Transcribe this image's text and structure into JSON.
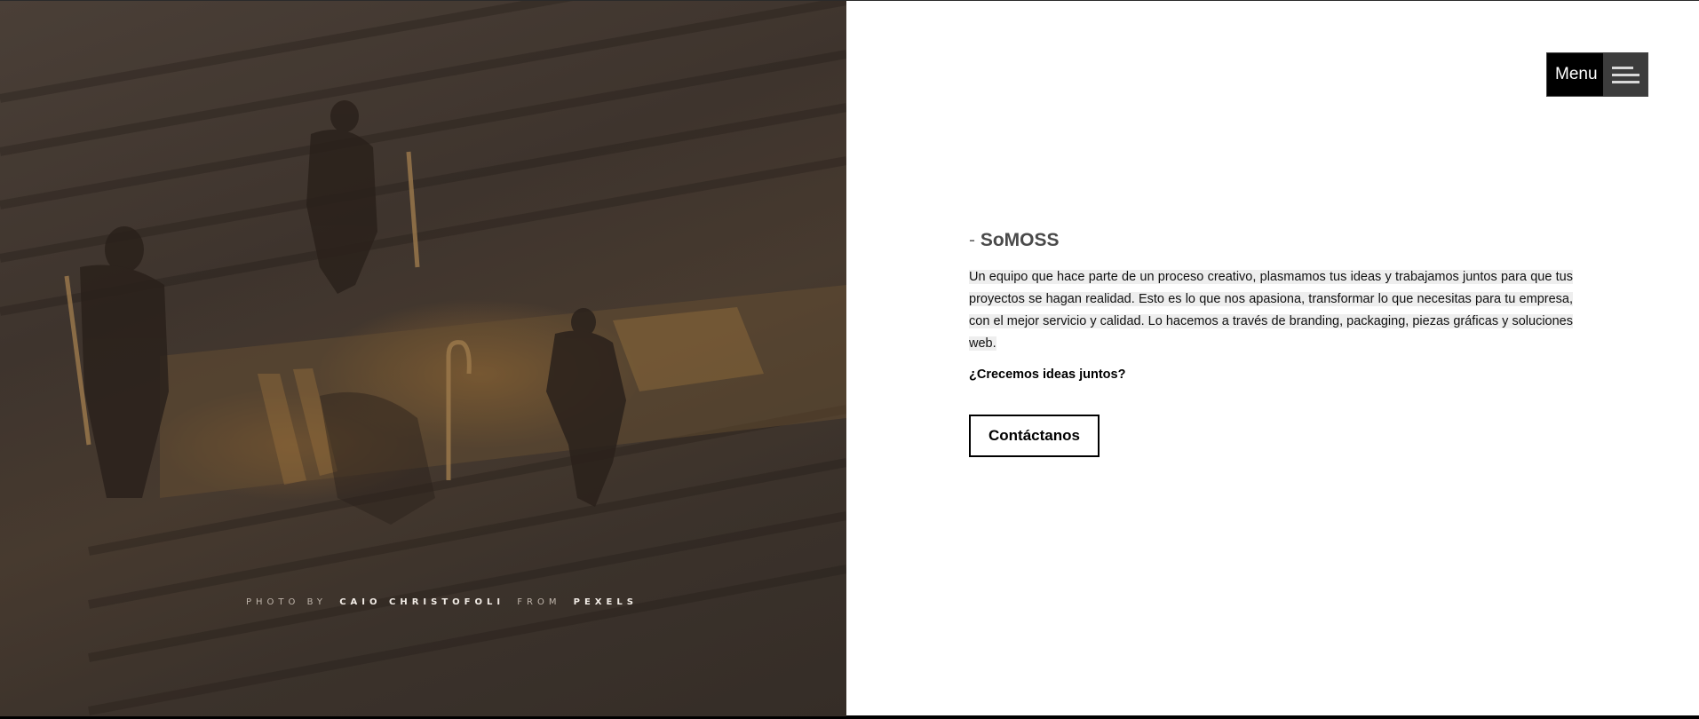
{
  "photo": {
    "credit_prefix": "PHOTO BY",
    "credit_author": "CAIO CHRISTOFOLI",
    "credit_middle": "FROM",
    "credit_source": "PEXELS"
  },
  "menu": {
    "label": "Menu",
    "icon": "hamburger-icon"
  },
  "content": {
    "dash": "-",
    "title": "SoMOSS",
    "description": "Un equipo que hace parte de un proceso creativo, plasmamos tus ideas y trabajamos juntos para que tus proyectos se hagan realidad. Esto es lo que nos apasiona, transformar lo que necesitas para tu empresa, con el mejor servicio y calidad. Lo hacemos a través de branding, packaging, piezas gráficas y soluciones web.",
    "question": "¿Crecemos ideas juntos?",
    "cta_label": "Contáctanos"
  },
  "colors": {
    "accent": "#000000",
    "photo_tone": "#3e342d",
    "highlight": "#eeeeee"
  }
}
